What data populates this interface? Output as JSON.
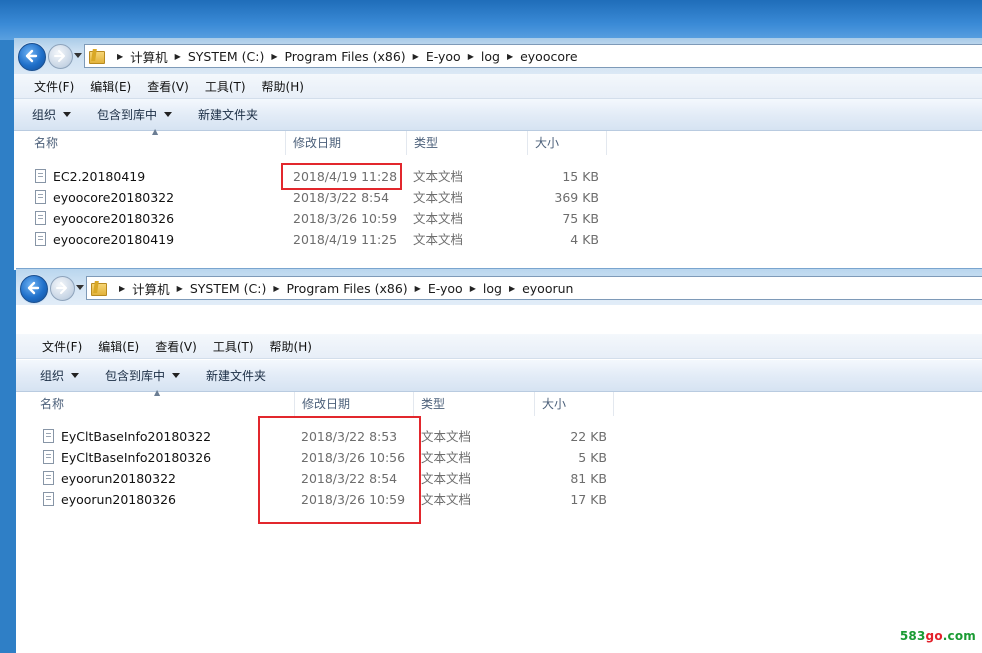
{
  "windows": [
    {
      "address": [
        "计算机",
        "SYSTEM (C:)",
        "Program Files (x86)",
        "E-yoo",
        "log",
        "eyoocore"
      ],
      "menu": [
        "文件(F)",
        "编辑(E)",
        "查看(V)",
        "工具(T)",
        "帮助(H)"
      ],
      "toolbar": {
        "organize": "组织",
        "include": "包含到库中",
        "new_folder": "新建文件夹"
      },
      "columns": {
        "name": "名称",
        "date": "修改日期",
        "type": "类型",
        "size": "大小"
      },
      "files": [
        {
          "name": "EC2.20180419",
          "date": "2018/4/19 11:28",
          "type": "文本文档",
          "size": "15 KB"
        },
        {
          "name": "eyoocore20180322",
          "date": "2018/3/22 8:54",
          "type": "文本文档",
          "size": "369 KB"
        },
        {
          "name": "eyoocore20180326",
          "date": "2018/3/26 10:59",
          "type": "文本文档",
          "size": "75 KB"
        },
        {
          "name": "eyoocore20180419",
          "date": "2018/4/19 11:25",
          "type": "文本文档",
          "size": "4 KB"
        }
      ]
    },
    {
      "address": [
        "计算机",
        "SYSTEM (C:)",
        "Program Files (x86)",
        "E-yoo",
        "log",
        "eyoorun"
      ],
      "menu": [
        "文件(F)",
        "编辑(E)",
        "查看(V)",
        "工具(T)",
        "帮助(H)"
      ],
      "toolbar": {
        "organize": "组织",
        "include": "包含到库中",
        "new_folder": "新建文件夹"
      },
      "columns": {
        "name": "名称",
        "date": "修改日期",
        "type": "类型",
        "size": "大小"
      },
      "files": [
        {
          "name": "EyCltBaseInfo20180322",
          "date": "2018/3/22 8:53",
          "type": "文本文档",
          "size": "22 KB"
        },
        {
          "name": "EyCltBaseInfo20180326",
          "date": "2018/3/26 10:56",
          "type": "文本文档",
          "size": "5 KB"
        },
        {
          "name": "eyoorun20180322",
          "date": "2018/3/22 8:54",
          "type": "文本文档",
          "size": "81 KB"
        },
        {
          "name": "eyoorun20180326",
          "date": "2018/3/26 10:59",
          "type": "文本文档",
          "size": "17 KB"
        }
      ]
    }
  ],
  "watermark": {
    "part1": "583",
    "part2": "go",
    "part3": ".com"
  },
  "colors": {
    "highlight": "#e2272d",
    "back_button": "#1f6fc9"
  }
}
